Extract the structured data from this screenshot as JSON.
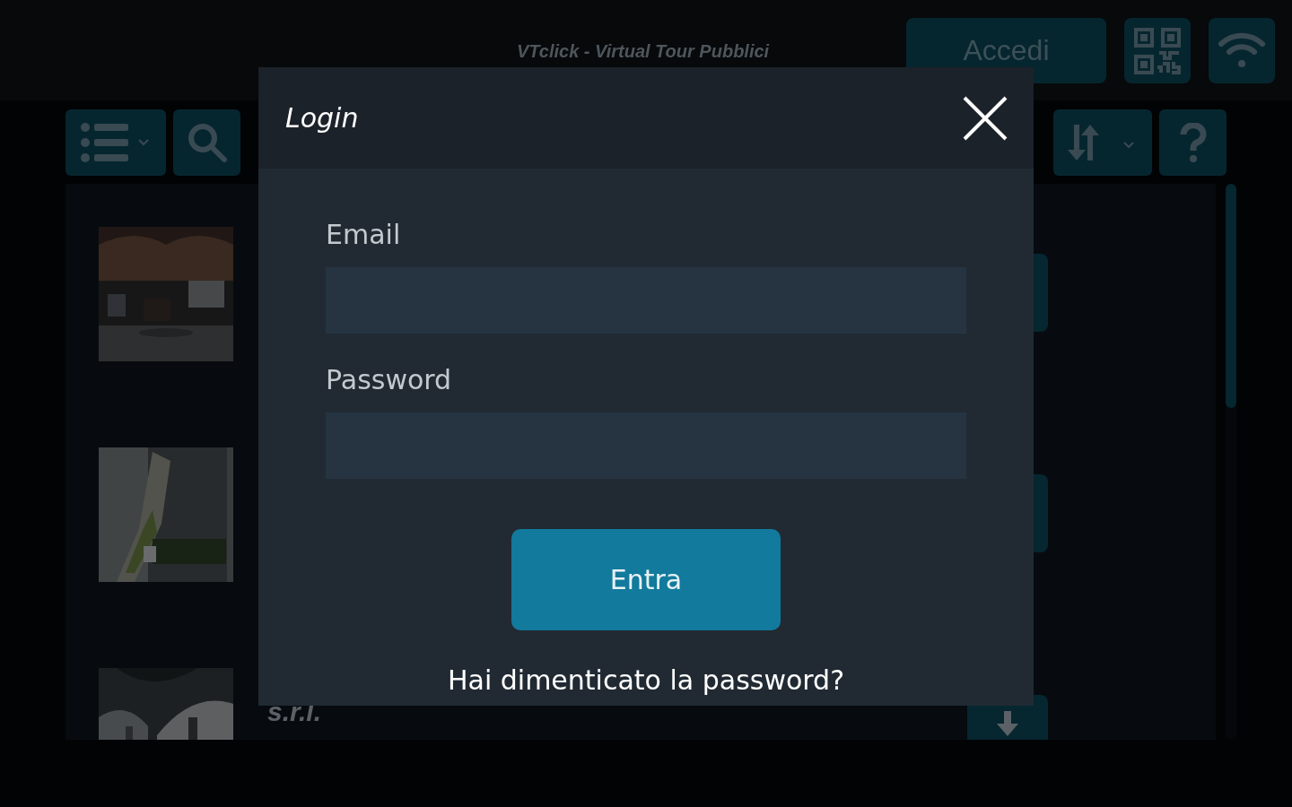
{
  "app": {
    "title": "VTclick - Virtual Tour Pubblici",
    "login_button": "Accedi"
  },
  "list": {
    "items": [
      {
        "thumbnail": {
          "kind": "picture"
        }
      },
      {
        "thumbnail": {
          "kind": "picture"
        }
      },
      {
        "thumbnail": {
          "kind": "picture"
        },
        "company": "s.r.l."
      }
    ]
  },
  "dialog": {
    "title": "Login",
    "fields": [
      {
        "label": "Email"
      },
      {
        "label": "Password"
      }
    ],
    "submit": "Entra",
    "forgot_link": "Hai dimenticato la password?"
  }
}
